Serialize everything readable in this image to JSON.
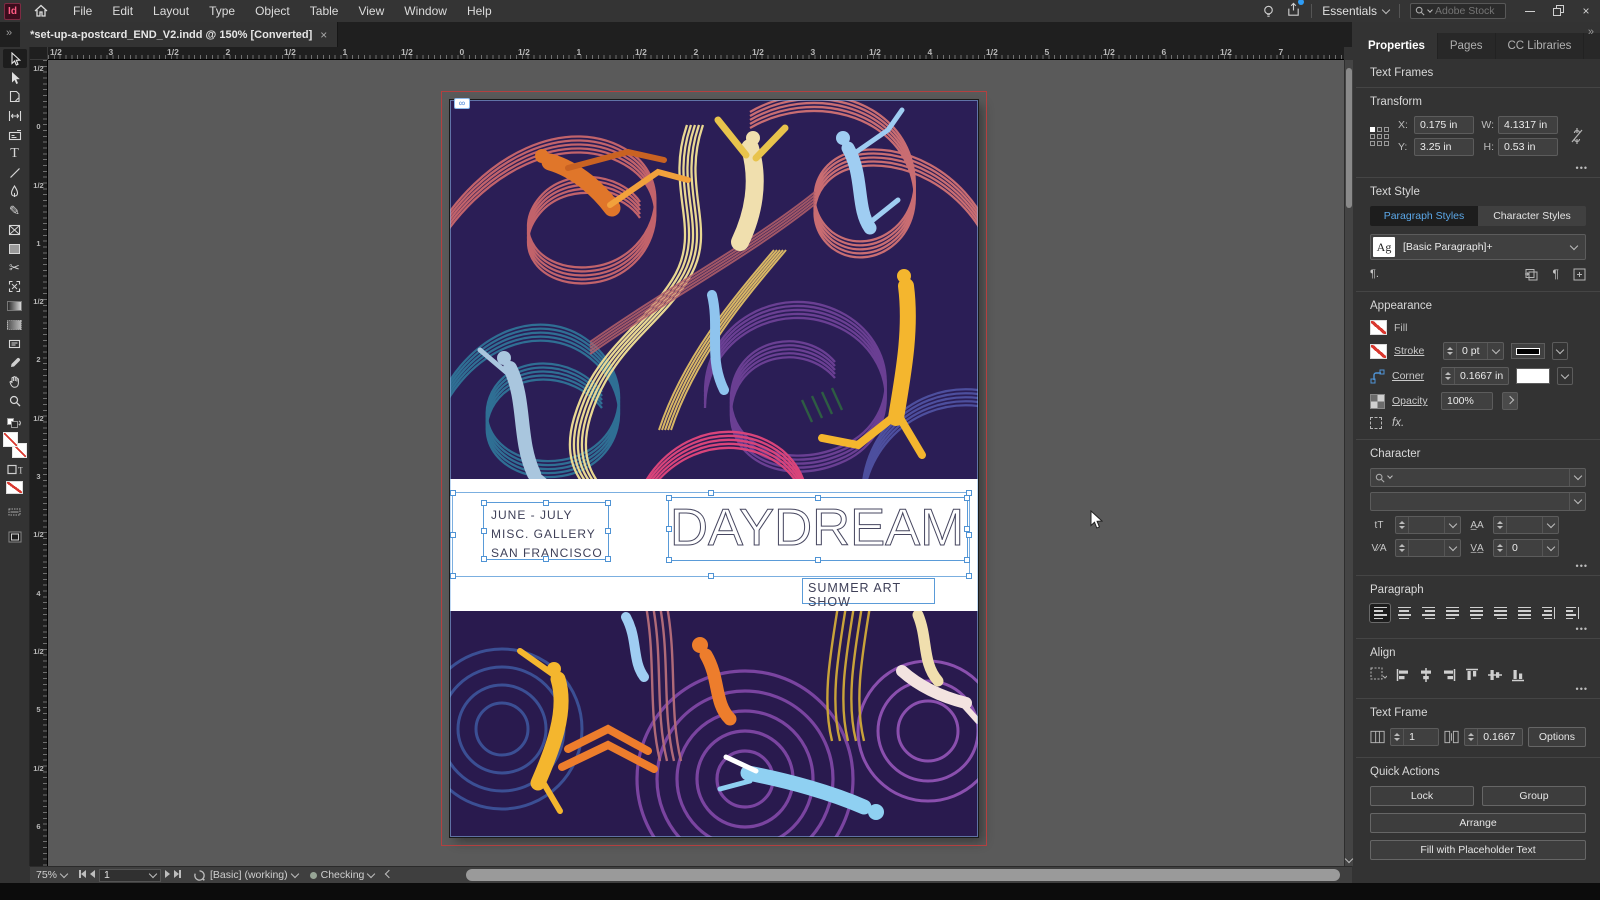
{
  "menubar": {
    "logo": "Id",
    "menus": [
      "File",
      "Edit",
      "Layout",
      "Type",
      "Object",
      "Table",
      "View",
      "Window",
      "Help"
    ],
    "workspace": "Essentials",
    "search_placeholder": "Adobe Stock"
  },
  "window_controls": {
    "close": "×"
  },
  "icons": {
    "double_chevron": "»",
    "more": "•••",
    "pilcrow": "¶.",
    "pilcrow_edit": "¶",
    "plus_box": "+",
    "fx": "fx.",
    "size": "tT",
    "leading": "A̲A",
    "kerning": "V⁄A",
    "tracking": "V̲A̲",
    "type_tool": "T",
    "pencil_tool": "✎",
    "scissors_tool": "✂",
    "link_badge": "∞",
    "swap": "⇄",
    "container_text": "T"
  },
  "tabbar": {
    "doc_tab": "*set-up-a-postcard_END_V2.indd @ 150% [Converted]",
    "close": "×"
  },
  "rulers": {
    "horizontal": [
      "1/2",
      "3",
      "1/2",
      "2",
      "1/2",
      "1",
      "1/2",
      "0",
      "1/2",
      "1",
      "1/2",
      "2",
      "1/2",
      "3",
      "1/2",
      "4",
      "1/2",
      "5",
      "1/2",
      "6",
      "1/2",
      "7"
    ],
    "vertical": [
      "1/2",
      "0",
      "1/2",
      "1",
      "1/2",
      "2",
      "1/2",
      "3",
      "1/2",
      "4",
      "1/2",
      "5",
      "1/2",
      "6"
    ]
  },
  "panel": {
    "tabs": [
      "Properties",
      "Pages",
      "CC Libraries"
    ],
    "selection_label": "Text Frames",
    "transform": {
      "title": "Transform",
      "x_label": "X:",
      "x": "0.175 in",
      "y_label": "Y:",
      "y": "3.25 in",
      "w_label": "W:",
      "w": "4.1317 in",
      "h_label": "H:",
      "h": "0.53 in"
    },
    "text_style": {
      "title": "Text Style",
      "tab_paragraph": "Paragraph Styles",
      "tab_character": "Character Styles",
      "style_sample": "Ag",
      "style_name": "[Basic Paragraph]+"
    },
    "appearance": {
      "title": "Appearance",
      "fill_label": "Fill",
      "stroke_label": "Stroke",
      "stroke_value": "0 pt",
      "corner_label": "Corner",
      "corner_value": "0.1667 in",
      "opacity_label": "Opacity",
      "opacity_value": "100%"
    },
    "character": {
      "title": "Character",
      "tracking_value": "0"
    },
    "paragraph": {
      "title": "Paragraph"
    },
    "align": {
      "title": "Align"
    },
    "text_frame": {
      "title": "Text Frame",
      "columns": "1",
      "gutter": "0.1667",
      "options_label": "Options"
    },
    "quick_actions": {
      "title": "Quick Actions",
      "lock": "Lock",
      "group": "Group",
      "arrange": "Arrange",
      "fill_placeholder": "Fill with Placeholder Text"
    }
  },
  "statusbar": {
    "zoom": "75%",
    "page": "1",
    "preset": "[Basic] (working)",
    "preflight": "Checking"
  },
  "document": {
    "dates_block": "JUNE - JULY\nMISC. GALLERY\nSAN FRANCISCO",
    "title": "DAYDREAM",
    "subtitle": "SUMMER ART SHOW"
  },
  "colors": {
    "selection_blue": "#5a9bd8",
    "panel_accent_blue": "#5ca8e8",
    "pasteboard_gray": "#5a5a5a",
    "illustration_bg_top": "#2b1e56",
    "illustration_bg_bottom": "#291a4e",
    "swatch_none_red": "#d9382f"
  }
}
